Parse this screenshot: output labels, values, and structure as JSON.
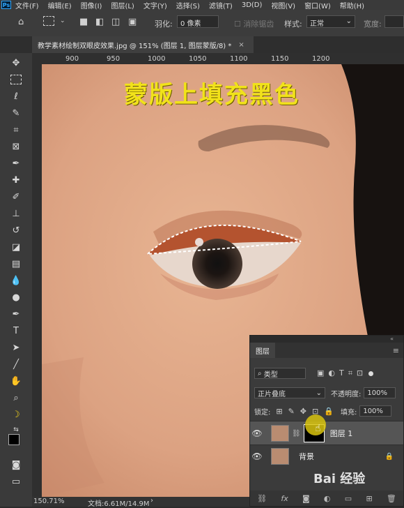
{
  "app": {
    "logo": "Ps"
  },
  "menu": [
    "文件(F)",
    "编辑(E)",
    "图像(I)",
    "图层(L)",
    "文字(Y)",
    "选择(S)",
    "滤镜(T)",
    "3D(D)",
    "视图(V)",
    "窗口(W)",
    "帮助(H)"
  ],
  "options": {
    "feather_label": "羽化:",
    "feather_value": "0 像素",
    "antialias_label": "消除锯齿",
    "style_label": "样式:",
    "style_value": "正常",
    "width_label": "宽度:"
  },
  "tab": {
    "title": "教学素材绘制双眼皮效果.jpg @ 151% (图层 1, 图层蒙版/8) *",
    "close": "×"
  },
  "ruler": {
    "ticks": [
      "900",
      "950",
      "1000",
      "1050",
      "1100",
      "1150",
      "1200"
    ]
  },
  "canvas": {
    "overlay_text": "蒙版上填充黑色"
  },
  "status": {
    "zoom": "150.71%",
    "doc": "文档:6.61M/14.9M"
  },
  "layers_panel": {
    "title": "图层",
    "filter_label": "类型",
    "blend_mode": "正片叠底",
    "opacity_label": "不透明度:",
    "opacity_value": "100%",
    "lock_label": "锁定:",
    "fill_label": "填充:",
    "fill_value": "100%",
    "layers": [
      {
        "name": "图层 1",
        "has_mask": true,
        "selected": true
      },
      {
        "name": "背景",
        "locked": true,
        "selected": false
      }
    ],
    "bottom_icons": [
      "link-icon",
      "fx-icon",
      "mask-icon",
      "adjust-icon",
      "folder-icon",
      "new-layer-icon",
      "trash-icon"
    ]
  },
  "watermark": "Bai 经验",
  "colors": {
    "accent_text": "#f1e21a",
    "skin": "#dba17f",
    "eyeshadow": "#b4532f"
  }
}
